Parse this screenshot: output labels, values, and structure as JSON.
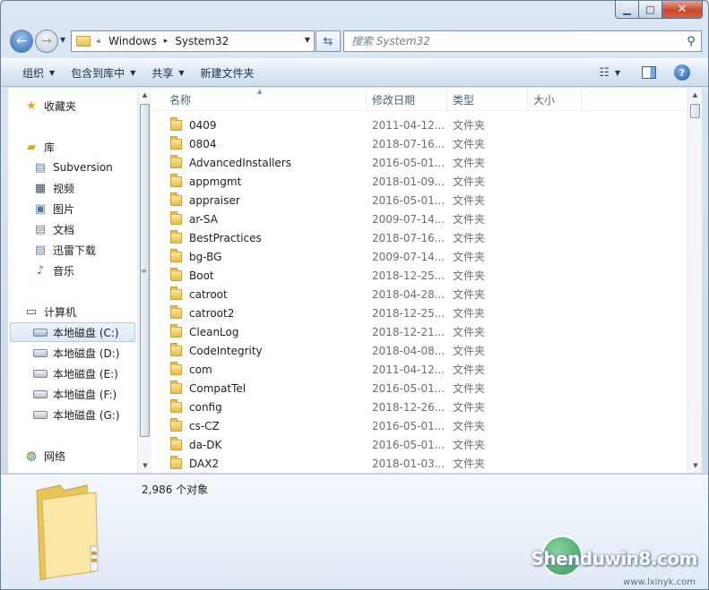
{
  "window": {
    "caption_buttons": [
      "minimize-icon",
      "maximize-icon",
      "close-icon"
    ]
  },
  "address": {
    "chevron": "«",
    "segments": [
      "Windows",
      "System32"
    ],
    "separator": "▸"
  },
  "search": {
    "placeholder": "搜索 System32"
  },
  "toolbar": {
    "organize": "组织",
    "include_in_library": "包含到库中",
    "share": "共享",
    "new_folder": "新建文件夹"
  },
  "nav": {
    "favorites": "收藏夹",
    "libraries": "库",
    "library_items": [
      "Subversion",
      "视频",
      "图片",
      "文档",
      "迅雷下载",
      "音乐"
    ],
    "computer": "计算机",
    "drives": [
      "本地磁盘 (C:)",
      "本地磁盘 (D:)",
      "本地磁盘 (E:)",
      "本地磁盘 (F:)",
      "本地磁盘 (G:)"
    ],
    "network": "网络"
  },
  "columns": {
    "name": "名称",
    "date": "修改日期",
    "type": "类型",
    "size": "大小"
  },
  "files": [
    {
      "name": "0409",
      "date": "2011-04-12...",
      "type": "文件夹"
    },
    {
      "name": "0804",
      "date": "2018-07-16...",
      "type": "文件夹"
    },
    {
      "name": "AdvancedInstallers",
      "date": "2016-05-01...",
      "type": "文件夹"
    },
    {
      "name": "appmgmt",
      "date": "2018-01-09...",
      "type": "文件夹"
    },
    {
      "name": "appraiser",
      "date": "2016-05-01...",
      "type": "文件夹"
    },
    {
      "name": "ar-SA",
      "date": "2009-07-14...",
      "type": "文件夹"
    },
    {
      "name": "BestPractices",
      "date": "2018-07-16...",
      "type": "文件夹"
    },
    {
      "name": "bg-BG",
      "date": "2009-07-14...",
      "type": "文件夹"
    },
    {
      "name": "Boot",
      "date": "2018-12-25...",
      "type": "文件夹"
    },
    {
      "name": "catroot",
      "date": "2018-04-28...",
      "type": "文件夹"
    },
    {
      "name": "catroot2",
      "date": "2018-12-25...",
      "type": "文件夹"
    },
    {
      "name": "CleanLog",
      "date": "2018-12-21...",
      "type": "文件夹"
    },
    {
      "name": "CodeIntegrity",
      "date": "2018-04-08...",
      "type": "文件夹"
    },
    {
      "name": "com",
      "date": "2011-04-12...",
      "type": "文件夹"
    },
    {
      "name": "CompatTel",
      "date": "2016-05-01...",
      "type": "文件夹"
    },
    {
      "name": "config",
      "date": "2018-12-26...",
      "type": "文件夹"
    },
    {
      "name": "cs-CZ",
      "date": "2016-05-01...",
      "type": "文件夹"
    },
    {
      "name": "da-DK",
      "date": "2016-05-01...",
      "type": "文件夹"
    },
    {
      "name": "DAX2",
      "date": "2018-01-03...",
      "type": "文件夹"
    }
  ],
  "details": {
    "count": "2,986 个对象"
  },
  "watermark": {
    "brand": "Shenduwin8.com",
    "url": "www.lxinyk.com"
  }
}
